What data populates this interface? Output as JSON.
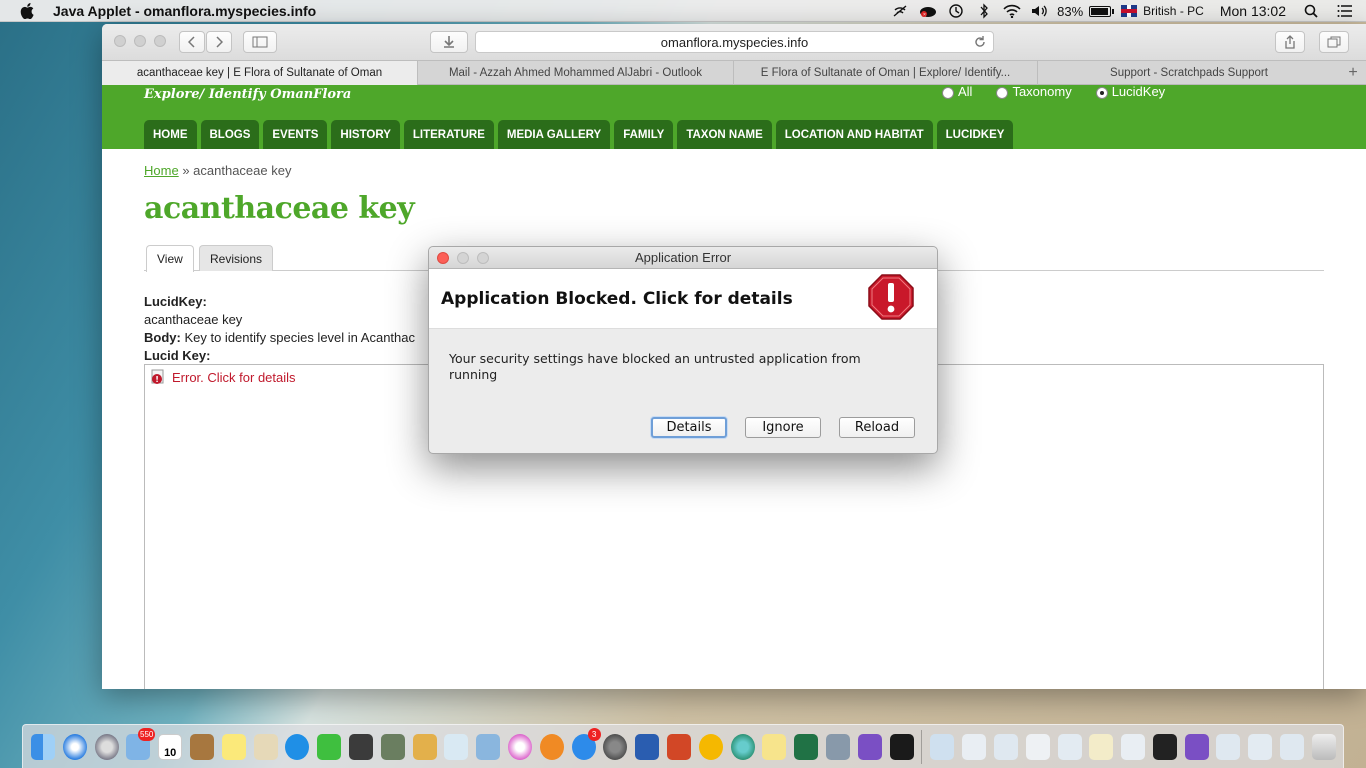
{
  "menubar": {
    "app_name": "Java Applet - omanflora.myspecies.info",
    "battery": "83%",
    "battery_level": 0.83,
    "input_source": "British - PC",
    "clock": "Mon 13:02"
  },
  "browser": {
    "url": "omanflora.myspecies.info",
    "tabs": [
      {
        "label": "acanthaceae key | E Flora of Sultanate of Oman"
      },
      {
        "label": "Mail - Azzah Ahmed Mohammed AlJabri - Outlook"
      },
      {
        "label": "E Flora of Sultanate of Oman | Explore/ Identify..."
      },
      {
        "label": "Support - Scratchpads Support"
      }
    ]
  },
  "site": {
    "tagline": "Explore/ Identify OmanFlora",
    "search_options": [
      {
        "label": "All",
        "selected": false
      },
      {
        "label": "Taxonomy",
        "selected": false
      },
      {
        "label": "LucidKey",
        "selected": true
      }
    ],
    "nav": [
      "HOME",
      "BLOGS",
      "EVENTS",
      "HISTORY",
      "LITERATURE",
      "MEDIA GALLERY",
      "FAMILY",
      "TAXON NAME",
      "LOCATION AND HABITAT",
      "LUCIDKEY"
    ]
  },
  "page": {
    "breadcrumb_home": "Home",
    "breadcrumb_sep": "»",
    "breadcrumb_current": "acanthaceae key",
    "title": "acanthaceae key",
    "tabs": [
      "View",
      "Revisions"
    ],
    "lucidkey_label": "LucidKey:",
    "lucidkey_value": "acanthaceae key",
    "body_label": "Body:",
    "body_value": "Key to identify species level in Acanthac",
    "lucid_key_label": "Lucid Key:",
    "applet_error": "Error. Click for details"
  },
  "dialog": {
    "title": "Application Error",
    "heading": "Application Blocked. Click for details",
    "message": "Your security settings have blocked an untrusted application from running",
    "buttons": {
      "details": "Details",
      "ignore": "Ignore",
      "reload": "Reload"
    }
  },
  "dock": {
    "badges": {
      "mail": "550",
      "calendar_day": "10",
      "app_store": "3"
    }
  }
}
